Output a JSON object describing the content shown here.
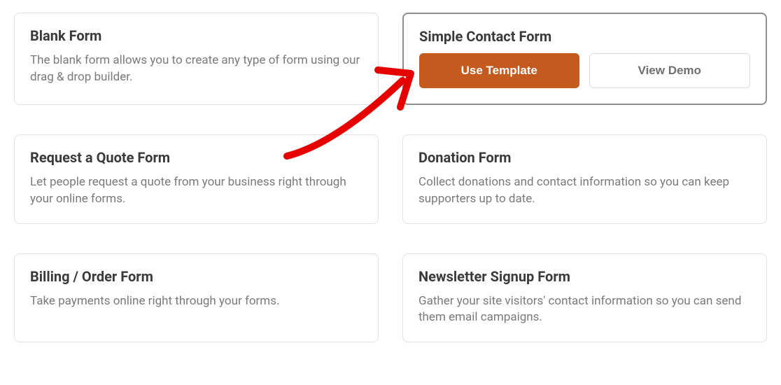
{
  "templates": [
    {
      "title": "Blank Form",
      "desc": "The blank form allows you to create any type of form using our drag & drop builder."
    },
    {
      "title": "Simple Contact Form",
      "use_label": "Use Template",
      "demo_label": "View Demo"
    },
    {
      "title": "Request a Quote Form",
      "desc": "Let people request a quote from your business right through your online forms."
    },
    {
      "title": "Donation Form",
      "desc": "Collect donations and contact information so you can keep supporters up to date."
    },
    {
      "title": "Billing / Order Form",
      "desc": "Take payments online right through your forms."
    },
    {
      "title": "Newsletter Signup Form",
      "desc": "Gather your site visitors' contact information so you can send them email campaigns."
    }
  ],
  "colors": {
    "accent": "#c55a1f",
    "annotation": "#e60000"
  }
}
